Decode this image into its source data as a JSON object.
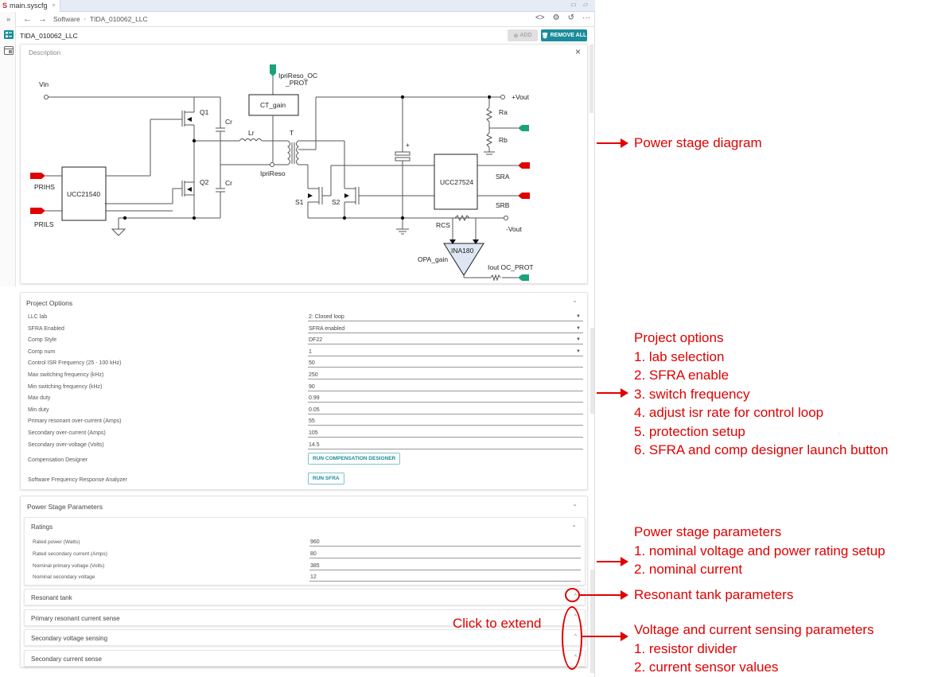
{
  "window": {
    "tab_label": "main.syscfg",
    "tab_logo": "S",
    "tab_close": "⌗",
    "window_controls": "▭ ▱"
  },
  "nav": {
    "breadcrumb": [
      "Software",
      "TIDA_010062_LLC"
    ],
    "back_icon": "←",
    "forward_icon": "→",
    "collapse_icon": "»",
    "right_icons": [
      "code-icon",
      "chip-icon",
      "history-icon",
      "more-icon"
    ]
  },
  "page": {
    "title": "TIDA_010062_LLC",
    "add_label": "ADD",
    "remove_all_label": "REMOVE ALL"
  },
  "description": {
    "label": "Description",
    "close_icon": "×",
    "diagram_labels": {
      "vin": "Vin",
      "q1": "Q1",
      "q2": "Q2",
      "cr1": "Cr",
      "cr2": "Cr",
      "lr": "Lr",
      "t": "T",
      "ct_gain": "CT_gain",
      "ipri_oc_1": "IpriReso_OC",
      "ipri_oc_2": "_PROT",
      "ipri_reso": "IpriReso",
      "ucc21540": "UCC21540",
      "prihs": "PRIHS",
      "prils": "PRILS",
      "s1": "S1",
      "s2": "S2",
      "plus": "+",
      "vout_plus": "+Vout",
      "ra": "Ra",
      "rb": "Rb",
      "ucc27524": "UCC27524",
      "sra": "SRA",
      "srb": "SRB",
      "rcs": "RCS",
      "vout_minus": "-Vout",
      "ina180": "INA180",
      "opa_gain": "OPA_gain",
      "iout_oc": "Iout OC_PROT"
    }
  },
  "project_options": {
    "title": "Project Options",
    "rows": [
      {
        "label": "LLC lab",
        "value": "2: Closed loop",
        "type": "select"
      },
      {
        "label": "SFRA Enabled",
        "value": "SFRA enabled",
        "type": "select"
      },
      {
        "label": "Comp Style",
        "value": "DF22",
        "type": "select"
      },
      {
        "label": "Comp num",
        "value": "1",
        "type": "select"
      },
      {
        "label": "Control ISR Frequency (25 - 100 kHz)",
        "value": "50",
        "type": "input"
      },
      {
        "label": "Max switching frequency (kHz)",
        "value": "250",
        "type": "input"
      },
      {
        "label": "Min switching frequency (kHz)",
        "value": "90",
        "type": "input"
      },
      {
        "label": "Max duty",
        "value": "0.99",
        "type": "input"
      },
      {
        "label": "Min duty",
        "value": "0.05",
        "type": "input"
      },
      {
        "label": "Primary resonant over-current (Amps)",
        "value": "55",
        "type": "input"
      },
      {
        "label": "Secondary over-current (Amps)",
        "value": "105",
        "type": "input"
      },
      {
        "label": "Secondary over-voltage (Volts)",
        "value": "14.5",
        "type": "input"
      }
    ],
    "comp_designer_label": "Compensation Designer",
    "comp_designer_button": "RUN COMPENSATION DESIGNER",
    "sfra_label": "Software Frequency Response Analyzer",
    "sfra_button": "RUN SFRA"
  },
  "power_stage": {
    "title": "Power Stage Parameters",
    "ratings": {
      "title": "Ratings",
      "rows": [
        {
          "label": "Rated power (Watts)",
          "value": "960"
        },
        {
          "label": "Rated secondary current (Amps)",
          "value": "80"
        },
        {
          "label": "Nominal primary voltage (Volts)",
          "value": "385"
        },
        {
          "label": "Nominal secondary voltage",
          "value": "12"
        }
      ]
    },
    "collapsed_sections": [
      "Resonant tank",
      "Primary resonant current sense",
      "Secondary voltage sensing",
      "Secondary current sense"
    ]
  },
  "annotations": {
    "power_stage_diagram": "Power stage diagram",
    "project_options": [
      "Project options",
      "1. lab selection",
      "2. SFRA enable",
      "3. switch frequency",
      "4. adjust isr rate for control loop",
      "5. protection setup",
      "6. SFRA and comp designer launch button"
    ],
    "power_stage_params": [
      "Power stage parameters",
      "1. nominal voltage and power rating setup",
      "2. nominal current"
    ],
    "resonant_tank": "Resonant tank parameters",
    "click_to_extend": "Click to extend",
    "sensing": [
      "Voltage and current sensing parameters",
      "1. resistor divider",
      "2. current sensor values"
    ],
    "color": "#e00000"
  },
  "colors": {
    "accent": "#1a8c9b",
    "signal_red": "#e00000",
    "signal_green": "#1aa37a",
    "ina_fill": "#dde6f2"
  }
}
